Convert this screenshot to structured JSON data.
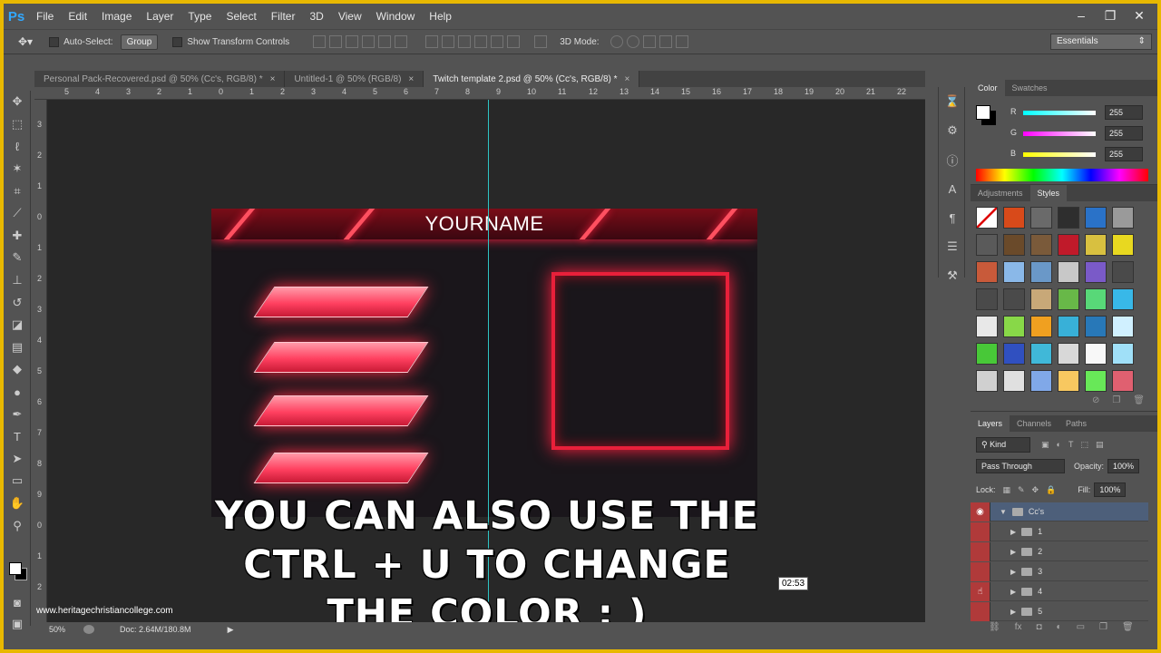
{
  "app": {
    "logo": "Ps"
  },
  "menu": [
    "File",
    "Edit",
    "Image",
    "Layer",
    "Type",
    "Select",
    "Filter",
    "3D",
    "View",
    "Window",
    "Help"
  ],
  "window_controls": [
    "–",
    "❐",
    "✕"
  ],
  "options": {
    "auto_select_label": "Auto-Select:",
    "auto_select_value": "Group",
    "show_transform_label": "Show Transform Controls",
    "mode_3d_label": "3D Mode:",
    "workspace": "Essentials"
  },
  "tabs": [
    {
      "label": "Personal Pack-Recovered.psd @ 50% (Cc's, RGB/8) *",
      "close": "×"
    },
    {
      "label": "Untitled-1 @ 50% (RGB/8)",
      "close": "×"
    },
    {
      "label": "Twitch template 2.psd @ 50% (Cc's, RGB/8) *",
      "close": "×"
    }
  ],
  "ruler_h": [
    "5",
    "4",
    "3",
    "2",
    "1",
    "0",
    "1",
    "2",
    "3",
    "4",
    "5",
    "6",
    "7",
    "8",
    "9",
    "10",
    "11",
    "12",
    "13",
    "14",
    "15",
    "16",
    "17",
    "18",
    "19",
    "20",
    "21",
    "22"
  ],
  "ruler_v": [
    "3",
    "2",
    "1",
    "0",
    "1",
    "2",
    "3",
    "4",
    "5",
    "6",
    "7",
    "8",
    "9",
    "0",
    "1",
    "2"
  ],
  "canvas": {
    "header_text": "YOURNAME",
    "caption_lines": [
      "YOU CAN ALSO USE THE",
      "CTRL + U TO CHANGE",
      "THE COLOR : )"
    ],
    "timestamp": "02:53"
  },
  "status": {
    "zoom": "50%",
    "doc": "Doc: 2.64M/180.8M"
  },
  "watermark": "www.heritagechristiancollege.com",
  "color_panel": {
    "tabs": [
      "Color",
      "Swatches"
    ],
    "r_label": "R",
    "g_label": "G",
    "b_label": "B",
    "r": "255",
    "g": "255",
    "b": "255"
  },
  "styles_panel": {
    "tabs": [
      "Adjustments",
      "Styles"
    ],
    "swatches": [
      "#ffffff",
      "#d84a1a",
      "#6a6a6a",
      "#2e2e2e",
      "#2a72c8",
      "#9a9a9a",
      "#5a5a5a",
      "#6a4a2a",
      "#7a5a3a",
      "#c01a2a",
      "#d8c040",
      "#e8d820",
      "#c85a3a",
      "#8ab8e8",
      "#6a98c8",
      "#c8c8c8",
      "#7a5ac8",
      "#4a4a4a",
      "#4a4a4a",
      "#4a4a4a",
      "#c8a878",
      "#68b848",
      "#58d878",
      "#38b8e8",
      "#e8e8e8",
      "#88d848",
      "#f0a020",
      "#38b0d8",
      "#2878b8",
      "#d0f0ff",
      "#48c838",
      "#3050c0",
      "#40b8d8",
      "#d8d8d8",
      "#f8f8f8",
      "#a0e0f8",
      "#d0d0d0",
      "#e0e0e0",
      "#80a8e8",
      "#f8c860",
      "#68e858",
      "#e06070"
    ]
  },
  "layers_panel": {
    "tabs": [
      "Layers",
      "Channels",
      "Paths"
    ],
    "filter": "Kind",
    "blend_mode": "Pass Through",
    "opacity_label": "Opacity:",
    "opacity": "100%",
    "lock_label": "Lock:",
    "fill_label": "Fill:",
    "fill": "100%",
    "group_name": "Cc's",
    "layers": [
      "1",
      "2",
      "3",
      "4",
      "5"
    ]
  }
}
